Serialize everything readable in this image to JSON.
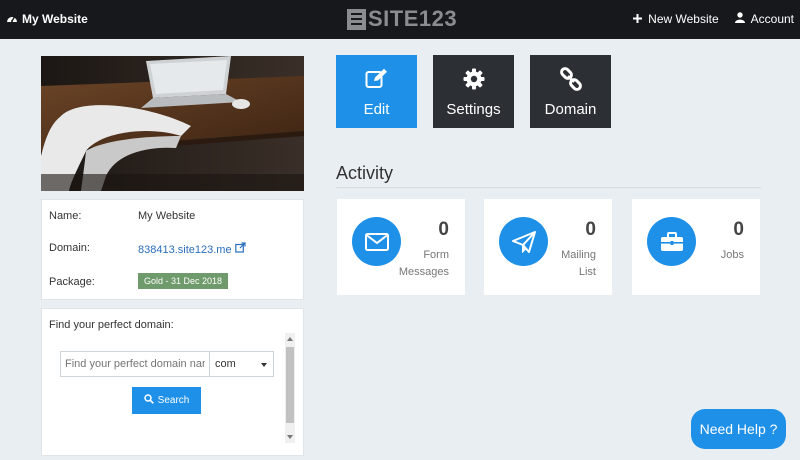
{
  "header": {
    "site_label": "My Website",
    "logo_text": "SITE123",
    "new_website_label": "New Website",
    "account_label": "Account"
  },
  "site_info": {
    "name_label": "Name:",
    "name_value": "My Website",
    "domain_label": "Domain:",
    "domain_value": "838413.site123.me",
    "package_label": "Package:",
    "package_value": "Gold - 31 Dec 2018"
  },
  "domain_finder": {
    "title": "Find your perfect domain:",
    "input_placeholder": "Find your perfect domain name",
    "tld_selected": "com",
    "search_label": "Search"
  },
  "actions": {
    "edit_label": "Edit",
    "settings_label": "Settings",
    "domain_label": "Domain"
  },
  "activity": {
    "title": "Activity",
    "stats": [
      {
        "count": "0",
        "label_line1": "Form",
        "label_line2": "Messages",
        "icon": "envelope-icon"
      },
      {
        "count": "0",
        "label_line1": "Mailing",
        "label_line2": "List",
        "icon": "paper-plane-icon"
      },
      {
        "count": "0",
        "label_line1": "Jobs",
        "label_line2": "",
        "icon": "briefcase-icon"
      }
    ]
  },
  "help": {
    "label": "Need Help ?"
  },
  "colors": {
    "accent": "#1e90e8",
    "topbar": "#16181b",
    "dark_button": "#2c2f33",
    "package_badge": "#6f9a6b",
    "background": "#e9eef3"
  }
}
